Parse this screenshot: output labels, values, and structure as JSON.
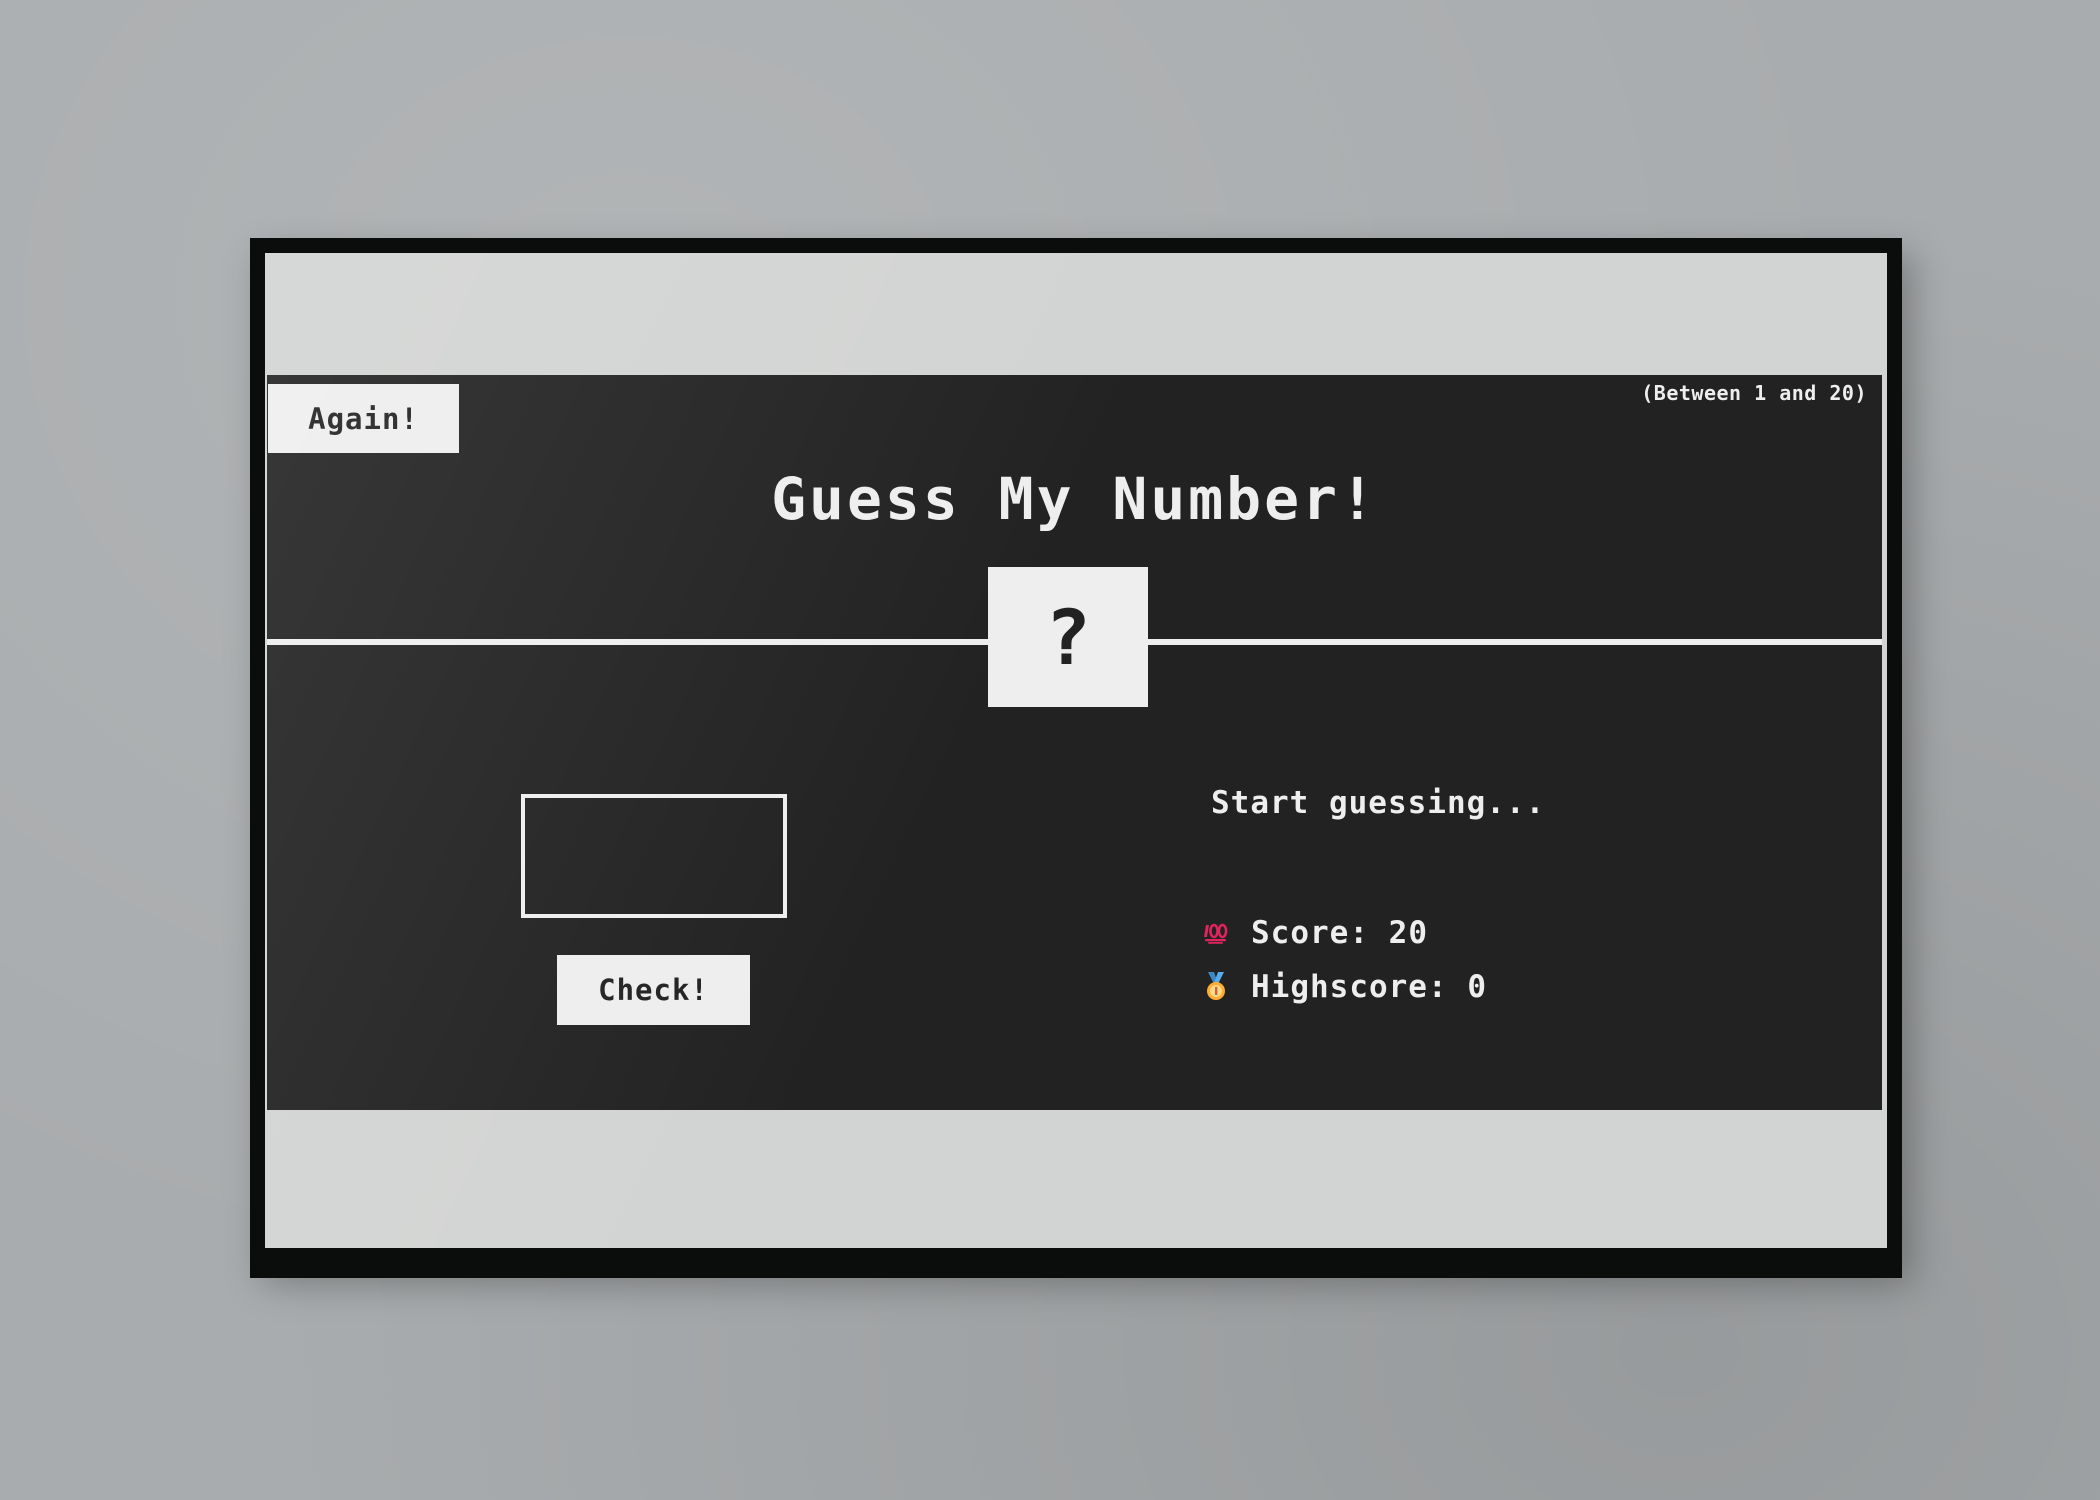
{
  "app": {
    "again_label": "Again!",
    "range_hint": "(Between 1 and 20)",
    "title": "Guess My Number!",
    "secret_number_display": "?",
    "guess_input_value": "",
    "check_label": "Check!",
    "message": "Start guessing...",
    "score_label": "Score:",
    "score_value": "20",
    "highscore_label": "Highscore:",
    "highscore_value": "0"
  },
  "icons": {
    "score": "hundred-points-icon",
    "highscore": "medal-icon"
  },
  "colors": {
    "background": "#222222",
    "foreground": "#eeeeee"
  }
}
